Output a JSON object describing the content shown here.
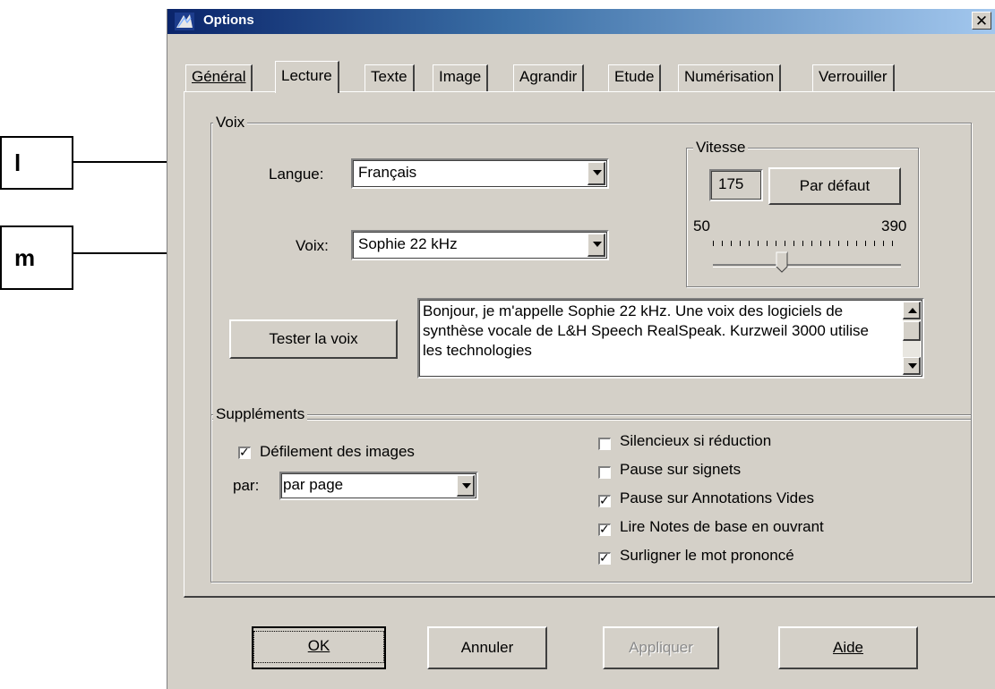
{
  "callouts": {
    "l": "l",
    "m": "m"
  },
  "window": {
    "title": "Options",
    "app_icon": "kurzweil-app-icon",
    "close_glyph": "✕"
  },
  "tabs": [
    {
      "label": "Général",
      "key": "G"
    },
    {
      "label": "Lecture",
      "key": "L"
    },
    {
      "label": "Texte",
      "key": "T"
    },
    {
      "label": "Image",
      "key": "I"
    },
    {
      "label": "Agrandir",
      "key": "A"
    },
    {
      "label": "Etude",
      "key": "d"
    },
    {
      "label": "Numérisation",
      "key": "N"
    },
    {
      "label": "Verrouiller",
      "key": "V"
    }
  ],
  "active_tab": "Lecture",
  "voix_group": {
    "legend": "Voix",
    "langue_label": "Langue:",
    "langue_value": "Français",
    "voix_label": "Voix:",
    "voix_value": "Sophie 22 kHz",
    "test_button": "Tester la voix",
    "sample_text": "Bonjour, je m'appelle Sophie 22 kHz. Une voix des logiciels de synthèse vocale de L&H Speech RealSpeak. Kurzweil 3000 utilise les technologies",
    "vitesse": {
      "legend": "Vitesse",
      "value": "175",
      "default_button": "Par défaut",
      "min_label": "50",
      "max_label": "390",
      "min": 50,
      "max": 390,
      "current": 175
    }
  },
  "supplements_group": {
    "legend": "Suppléments",
    "defilement_label": "Défilement des images",
    "defilement_checked": true,
    "par_label": "par:",
    "par_value": "par page",
    "options": [
      {
        "label": "Silencieux si réduction",
        "checked": false
      },
      {
        "label": "Pause sur signets",
        "checked": false
      },
      {
        "label": "Pause sur Annotations Vides",
        "checked": true
      },
      {
        "label": "Lire Notes de base en ouvrant",
        "checked": true
      },
      {
        "label": "Surligner le mot prononcé",
        "checked": true
      }
    ]
  },
  "buttons": {
    "ok": "OK",
    "cancel": "Annuler",
    "apply": "Appliquer",
    "help": "Aide"
  }
}
